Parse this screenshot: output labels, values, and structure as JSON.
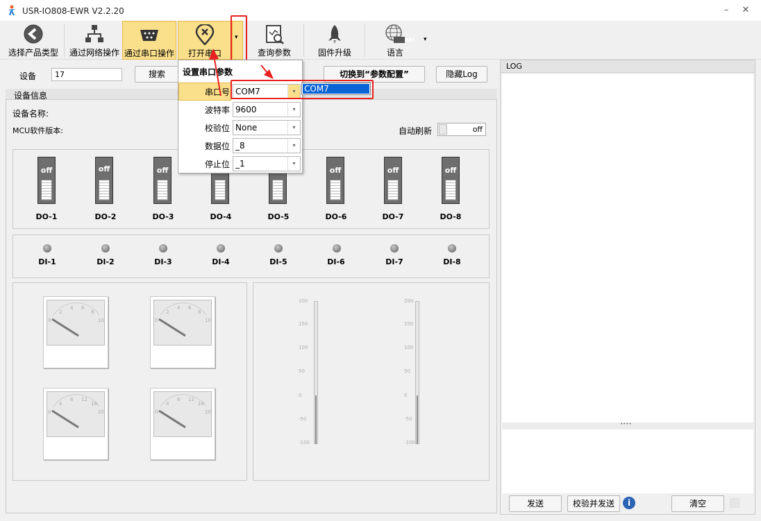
{
  "window": {
    "title": "USR-IO808-EWR V2.2.20",
    "minimize": "–",
    "close": "✕"
  },
  "toolbar": {
    "select_product": "选择产品类型",
    "network_op": "通过网络操作",
    "serial_op": "通过串口操作",
    "open_serial": "打开串口",
    "query_params": "查询参数",
    "firmware": "固件升级",
    "language": "语言",
    "language_icon_text": "ABC",
    "dropdown_arrow": "▾"
  },
  "device_bar": {
    "label": "设备",
    "value": "17",
    "search": "搜索",
    "switch_config": "切换到“参数配置”",
    "hide_log": "隐藏Log"
  },
  "device_info": {
    "group_title": "设备信息",
    "name_label": "设备名称:",
    "mcu_label": "MCU软件版本:",
    "auto_refresh": "自动刷新",
    "toggle_state": "off"
  },
  "do_switches": [
    {
      "label": "DO-1",
      "state": "off"
    },
    {
      "label": "DO-2",
      "state": "off"
    },
    {
      "label": "DO-3",
      "state": "off"
    },
    {
      "label": "DO-4",
      "state": "off"
    },
    {
      "label": "DO-5",
      "state": "off"
    },
    {
      "label": "DO-6",
      "state": "off"
    },
    {
      "label": "DO-7",
      "state": "off"
    },
    {
      "label": "DO-8",
      "state": "off"
    }
  ],
  "di_inputs": [
    "DI-1",
    "DI-2",
    "DI-3",
    "DI-4",
    "DI-5",
    "DI-6",
    "DI-7",
    "DI-8"
  ],
  "gauges": {
    "g1": [
      "0",
      "2",
      "4",
      "6",
      "8",
      "10"
    ],
    "g2": [
      "0",
      "2",
      "4",
      "6",
      "8",
      "10"
    ],
    "g3": [
      "0",
      "4",
      "8",
      "12",
      "16",
      "20"
    ],
    "g4": [
      "0",
      "4",
      "8",
      "12",
      "16",
      "20"
    ]
  },
  "scale_ticks": [
    "200",
    "150",
    "100",
    "50",
    "0",
    "-50",
    "-100"
  ],
  "serial_popup": {
    "title": "设置串口参数",
    "fields": [
      {
        "label": "串口号",
        "value": "COM7"
      },
      {
        "label": "波特率",
        "value": "9600"
      },
      {
        "label": "校验位",
        "value": "None"
      },
      {
        "label": "数据位",
        "value": "_8"
      },
      {
        "label": "停止位",
        "value": "_1"
      }
    ],
    "port_option": "COM7"
  },
  "log": {
    "title": "LOG",
    "splitter": "••••",
    "send": "发送",
    "verify_send": "校验并发送",
    "info_icon": "i",
    "clear": "清空"
  },
  "colors": {
    "accent_yellow": "#fbe08c",
    "highlight_red": "#e8201e",
    "selection_blue": "#0a64d6"
  }
}
